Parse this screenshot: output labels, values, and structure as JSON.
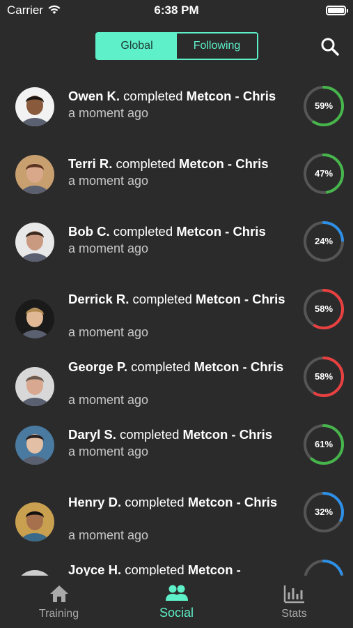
{
  "status_bar": {
    "carrier": "Carrier",
    "time": "6:38 PM"
  },
  "header": {
    "tabs": [
      {
        "label": "Global",
        "selected": true
      },
      {
        "label": "Following",
        "selected": false
      }
    ],
    "search_icon": "search-icon"
  },
  "feed": [
    {
      "name": "Owen K.",
      "verb": " completed ",
      "workout": "Metcon - Chris",
      "time": "a moment ago",
      "percent_label": "59%",
      "percent": 59,
      "ring_color": "#46b54b"
    },
    {
      "name": "Terri R.",
      "verb": " completed ",
      "workout": "Metcon - Chris",
      "time": "a moment ago",
      "percent_label": "47%",
      "percent": 47,
      "ring_color": "#46b54b"
    },
    {
      "name": "Bob C.",
      "verb": " completed ",
      "workout": "Metcon - Chris",
      "time": "a moment ago",
      "percent_label": "24%",
      "percent": 24,
      "ring_color": "#2d8fe6"
    },
    {
      "name": "Derrick R.",
      "verb": " completed ",
      "workout": "Metcon - Chris",
      "time": "a moment ago",
      "percent_label": "58%",
      "percent": 58,
      "ring_color": "#e84040"
    },
    {
      "name": "George P.",
      "verb": " completed ",
      "workout": "Metcon - Chris",
      "time": "a moment ago",
      "percent_label": "58%",
      "percent": 58,
      "ring_color": "#e84040"
    },
    {
      "name": "Daryl S.",
      "verb": " completed ",
      "workout": "Metcon - Chris",
      "time": "a moment ago",
      "percent_label": "61%",
      "percent": 61,
      "ring_color": "#46b54b"
    },
    {
      "name": "Henry D.",
      "verb": " completed ",
      "workout": "Metcon - Chris",
      "time": "a moment ago",
      "percent_label": "32%",
      "percent": 32,
      "ring_color": "#2d8fe6"
    },
    {
      "name": "Joyce H.",
      "verb": " completed ",
      "workout": "Metcon -",
      "time": "",
      "percent_label": "",
      "percent": 20,
      "ring_color": "#2d8fe6"
    }
  ],
  "tabbar": {
    "tabs": [
      {
        "label": "Training",
        "icon": "home-icon",
        "active": false
      },
      {
        "label": "Social",
        "icon": "people-icon",
        "active": true
      },
      {
        "label": "Stats",
        "icon": "bar-chart-icon",
        "active": false
      }
    ]
  },
  "colors": {
    "accent": "#5ef0c8",
    "background": "#2b2b2b",
    "ring_track": "#555555"
  }
}
